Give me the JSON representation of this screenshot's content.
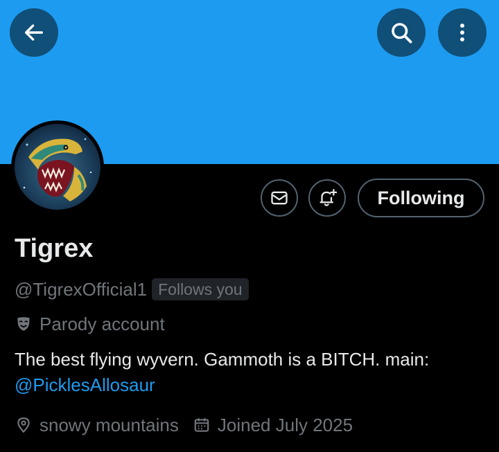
{
  "profile": {
    "name": "Tigrex",
    "handle": "@TigrexOfficial1",
    "follows_you": "Follows you",
    "parody_label": "Parody account",
    "bio_text": "The best flying wyvern. Gammoth is a BITCH.  main:",
    "bio_mention": "@PicklesAllosaur",
    "location": "snowy mountains",
    "joined": "Joined July 2025"
  },
  "actions": {
    "following_label": "Following"
  },
  "icons": {
    "back": "back-arrow-icon",
    "search": "search-icon",
    "more": "more-vertical-icon",
    "message": "envelope-icon",
    "notifications": "bell-plus-icon",
    "parody": "theater-mask-icon",
    "location": "location-pin-icon",
    "calendar": "calendar-icon"
  },
  "colors": {
    "banner": "#1d9bf0",
    "accent": "#1d9bf0",
    "background": "#000000",
    "primary_text": "#e7e9ea",
    "secondary_text": "#71767b"
  }
}
